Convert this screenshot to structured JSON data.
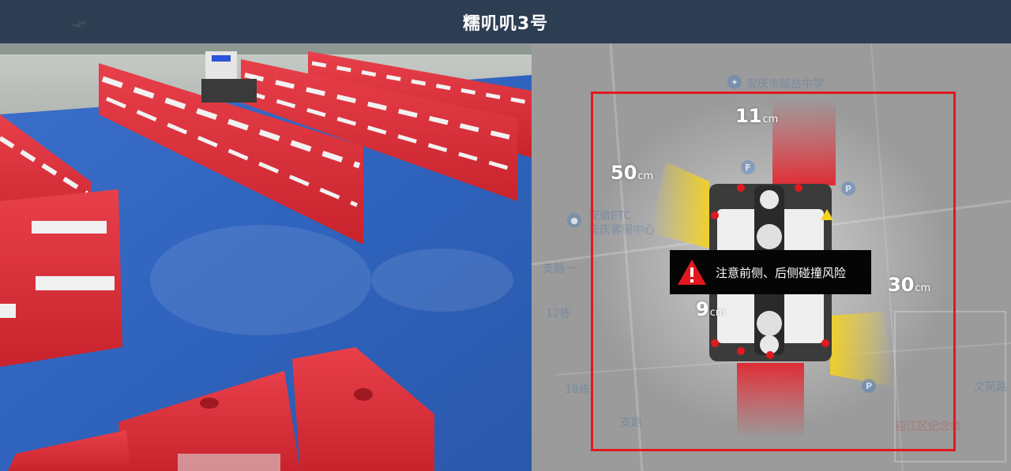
{
  "header": {
    "title": "糯叽叽3号"
  },
  "map": {
    "labels": {
      "school": "安庆市赋岳中学",
      "etc_line1": "安徽ETC",
      "etc_line2": "安庆客服中心",
      "road1": "支路一",
      "road2": "支路",
      "road3": "文苑路",
      "num1": "12栋",
      "num2": "18栋",
      "place": "迎江区纪念委"
    },
    "distances": {
      "front": {
        "value": "11",
        "unit": "cm"
      },
      "front_left": {
        "value": "50",
        "unit": "cm"
      },
      "rear_right": {
        "value": "30",
        "unit": "cm"
      },
      "rear_left": {
        "value": "9",
        "unit": "cm"
      }
    },
    "alert": {
      "message": "注意前侧、后侧碰撞风险",
      "icon": "warning-triangle-icon"
    }
  },
  "colors": {
    "header_bg": "#2d3d52",
    "zone_border": "#e1191e",
    "alert_bg": "#050505",
    "danger_red": "#e1191e",
    "warning_yellow": "#f5d21e"
  }
}
